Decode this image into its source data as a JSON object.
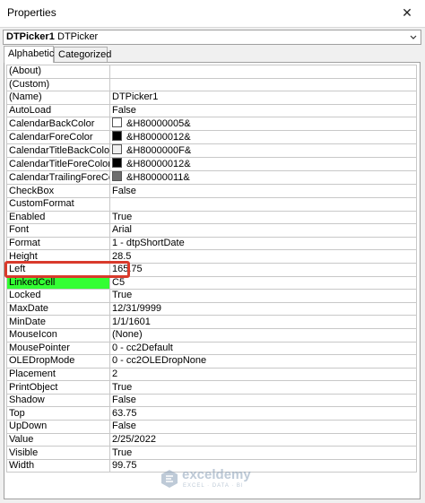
{
  "window": {
    "title": "Properties",
    "close_glyph": "✕"
  },
  "object_selector": {
    "name": "DTPicker1",
    "type": "DTPicker"
  },
  "tabs": [
    {
      "label": "Alphabetic",
      "active": true
    },
    {
      "label": "Categorized",
      "active": false
    }
  ],
  "properties": [
    {
      "name": "(About)",
      "value": ""
    },
    {
      "name": "(Custom)",
      "value": ""
    },
    {
      "name": "(Name)",
      "value": "DTPicker1"
    },
    {
      "name": "AutoLoad",
      "value": "False"
    },
    {
      "name": "CalendarBackColor",
      "value": "&H80000005&",
      "swatch": "#ffffff"
    },
    {
      "name": "CalendarForeColor",
      "value": "&H80000012&",
      "swatch": "#000000"
    },
    {
      "name": "CalendarTitleBackColor",
      "value": "&H8000000F&",
      "swatch": "#f0f0f0"
    },
    {
      "name": "CalendarTitleForeColor",
      "value": "&H80000012&",
      "swatch": "#000000"
    },
    {
      "name": "CalendarTrailingForeColor",
      "value": "&H80000011&",
      "swatch": "#6d6d6d"
    },
    {
      "name": "CheckBox",
      "value": "False"
    },
    {
      "name": "CustomFormat",
      "value": ""
    },
    {
      "name": "Enabled",
      "value": "True"
    },
    {
      "name": "Font",
      "value": "Arial"
    },
    {
      "name": "Format",
      "value": "1 - dtpShortDate"
    },
    {
      "name": "Height",
      "value": "28.5"
    },
    {
      "name": "Left",
      "value": "165.75"
    },
    {
      "name": "LinkedCell",
      "value": "C5",
      "highlight": true
    },
    {
      "name": "Locked",
      "value": "True"
    },
    {
      "name": "MaxDate",
      "value": "12/31/9999"
    },
    {
      "name": "MinDate",
      "value": "1/1/1601"
    },
    {
      "name": "MouseIcon",
      "value": "(None)"
    },
    {
      "name": "MousePointer",
      "value": "0 - cc2Default"
    },
    {
      "name": "OLEDropMode",
      "value": "0 - cc2OLEDropNone"
    },
    {
      "name": "Placement",
      "value": "2"
    },
    {
      "name": "PrintObject",
      "value": "True"
    },
    {
      "name": "Shadow",
      "value": "False"
    },
    {
      "name": "Top",
      "value": "63.75"
    },
    {
      "name": "UpDown",
      "value": "False"
    },
    {
      "name": "Value",
      "value": "2/25/2022"
    },
    {
      "name": "Visible",
      "value": "True"
    },
    {
      "name": "Width",
      "value": "99.75"
    }
  ],
  "colors": {
    "highlight_cell": "#33ff33",
    "highlight_border": "#d93a2b"
  },
  "watermark": {
    "name": "exceldemy",
    "sub": "EXCEL · DATA · BI"
  }
}
